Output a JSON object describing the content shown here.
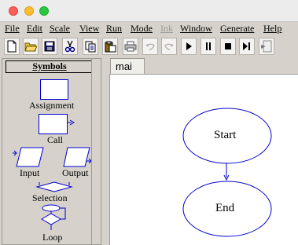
{
  "window": {
    "controls": [
      "close",
      "minimize",
      "zoom"
    ]
  },
  "menu": [
    {
      "label": "File",
      "disabled": false
    },
    {
      "label": "Edit",
      "disabled": false
    },
    {
      "label": "Scale",
      "disabled": false
    },
    {
      "label": "View",
      "disabled": false
    },
    {
      "label": "Run",
      "disabled": false
    },
    {
      "label": "Mode",
      "disabled": false
    },
    {
      "label": "Ink",
      "disabled": true
    },
    {
      "label": "Window",
      "disabled": false
    },
    {
      "label": "Generate",
      "disabled": false
    },
    {
      "label": "Help",
      "disabled": false
    }
  ],
  "toolbar": [
    {
      "icon": "new-file-icon",
      "enabled": true
    },
    {
      "icon": "open-folder-icon",
      "enabled": true
    },
    {
      "icon": "save-icon",
      "enabled": true
    },
    {
      "icon": "cut-icon",
      "enabled": true
    },
    {
      "icon": "copy-icon",
      "enabled": true
    },
    {
      "icon": "paste-icon",
      "enabled": true
    },
    {
      "icon": "print-icon",
      "enabled": true
    },
    {
      "icon": "undo-icon",
      "enabled": false
    },
    {
      "icon": "redo-icon",
      "enabled": false
    },
    {
      "icon": "play-icon",
      "enabled": true
    },
    {
      "icon": "pause-icon",
      "enabled": true
    },
    {
      "icon": "stop-icon",
      "enabled": true
    },
    {
      "icon": "step-icon",
      "enabled": true
    },
    {
      "icon": "step-into-icon",
      "enabled": true
    }
  ],
  "sidebar": {
    "title": "Symbols",
    "symbols": [
      {
        "label": "Assignment",
        "shape": "rectangle"
      },
      {
        "label": "Call",
        "shape": "call-box"
      },
      {
        "label": "Input",
        "shape": "parallelogram"
      },
      {
        "label": "Output",
        "shape": "parallelogram"
      },
      {
        "label": "Selection",
        "shape": "diamond"
      },
      {
        "label": "Loop",
        "shape": "loop"
      }
    ]
  },
  "tab": {
    "label": "mai"
  },
  "flowchart": {
    "nodes": [
      {
        "label": "Start",
        "shape": "ellipse"
      },
      {
        "label": "End",
        "shape": "ellipse"
      }
    ],
    "edge_color": "#0000cc"
  },
  "colors": {
    "window_bg": "#d6d2cb",
    "canvas_bg": "#ffffff",
    "symbol_stroke": "#0000cc"
  }
}
